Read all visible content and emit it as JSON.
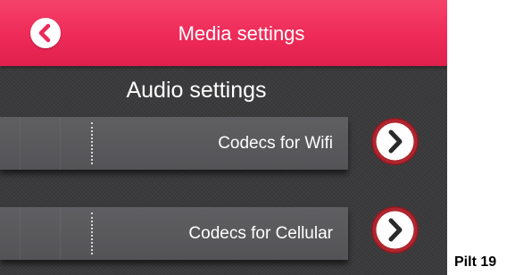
{
  "header": {
    "title": "Media settings",
    "back_icon": "chevron-left-icon"
  },
  "section": {
    "title": "Audio settings"
  },
  "rows": [
    {
      "label": "Codecs for Wifi",
      "action_icon": "chevron-right-icon"
    },
    {
      "label": "Codecs for Cellular",
      "action_icon": "chevron-right-icon"
    }
  ],
  "caption": "Pilt 19",
  "colors": {
    "header_accent": "#ee2a58",
    "background": "#3b3b3d",
    "row_background": "#5a5a5d",
    "button_ring": "#a8202a",
    "text": "#ffffff"
  }
}
